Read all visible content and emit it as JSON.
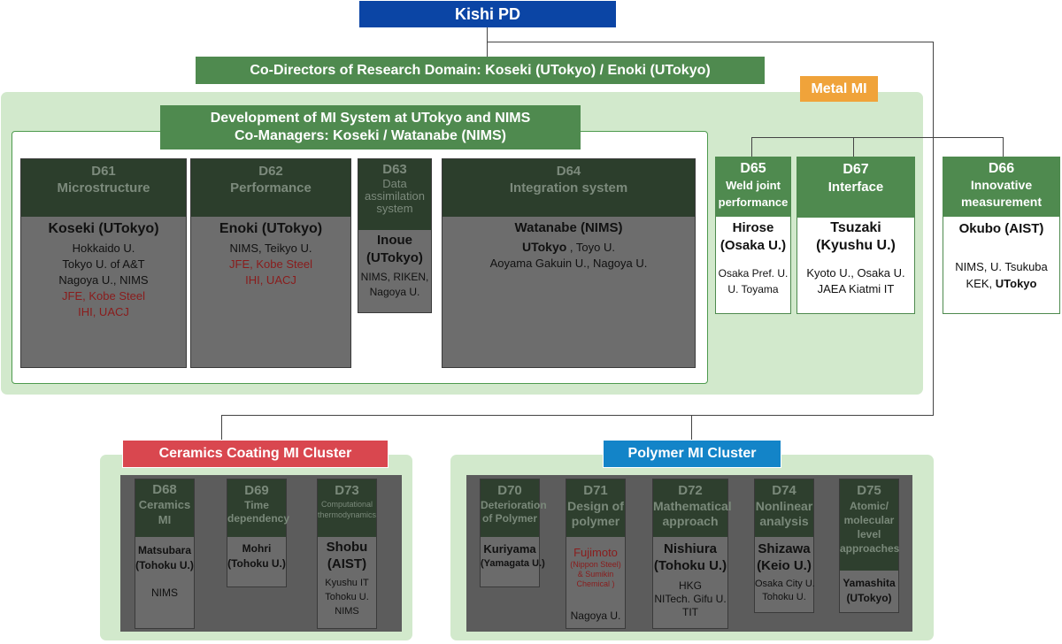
{
  "pd": "Kishi PD",
  "codirectors": "Co-Directors of Research Domain: Koseki (UTokyo) / Enoki (UTokyo)",
  "metal_label": "Metal MI",
  "dev": {
    "line1": "Development of MI System at UTokyo and NIMS",
    "line2": "Co-Managers: Koseki / Watanabe (NIMS)"
  },
  "d61": {
    "code": "D61",
    "title": "Microstructure",
    "leader": "Koseki (UTokyo)",
    "m1": "Hokkaido U.",
    "m2": "Tokyo U. of A&T",
    "m3": "Nagoya U., NIMS",
    "m4": "JFE, Kobe Steel",
    "m5": "IHI, UACJ"
  },
  "d62": {
    "code": "D62",
    "title": "Performance",
    "leader": "Enoki (UTokyo)",
    "m1": "NIMS, Teikyo U.",
    "m2": "JFE, Kobe Steel",
    "m3": "IHI, UACJ"
  },
  "d63": {
    "code": "D63",
    "t1": "Data",
    "t2": "assimilation",
    "t3": "system",
    "l1": "Inoue",
    "l2": "(UTokyo)",
    "m1": "NIMS, RIKEN,",
    "m2": "Nagoya U."
  },
  "d64": {
    "code": "D64",
    "title": "Integration system",
    "leader": "Watanabe (NIMS)",
    "m1a": "UTokyo",
    "m1b": " , Toyo U.",
    "m2": "Aoyama Gakuin U., Nagoya U."
  },
  "d65": {
    "code": "D65",
    "t1": "Weld joint",
    "t2": "performance",
    "l1": "Hirose",
    "l2": "(Osaka U.)",
    "m1": "Osaka Pref. U.",
    "m2": "U. Toyama"
  },
  "d67": {
    "code": "D67",
    "title": "Interface",
    "l1": "Tsuzaki",
    "l2": "(Kyushu U.)",
    "m1": "Kyoto U., Osaka U.",
    "m2": "JAEA Kiatmi IT"
  },
  "d66": {
    "code": "D66",
    "t1": "Innovative",
    "t2": "measurement",
    "leader": "Okubo (AIST)",
    "m1": "NIMS, U. Tsukuba",
    "m2a": "KEK, ",
    "m2b": "UTokyo"
  },
  "ceramics": "Ceramics Coating MI Cluster",
  "polymer": "Polymer MI Cluster",
  "d68": {
    "code": "D68",
    "t1": "Ceramics",
    "t2": "MI",
    "l1": "Matsubara",
    "l2": "(Tohoku U.)",
    "m1": "NIMS"
  },
  "d69": {
    "code": "D69",
    "t1": "Time",
    "t2": "dependency",
    "l1": "Mohri",
    "l2": "(Tohoku U.)"
  },
  "d73": {
    "code": "D73",
    "t1": "Computational",
    "t2": "thermodynamics",
    "l1": "Shobu",
    "l2": "(AIST)",
    "m1": "Kyushu IT",
    "m2": "Tohoku U.",
    "m3": "NIMS"
  },
  "d70": {
    "code": "D70",
    "t1": "Deterioration",
    "t2": "of Polymer",
    "l1": "Kuriyama",
    "l2": "(Yamagata U.)"
  },
  "d71": {
    "code": "D71",
    "t1": "Design of",
    "t2": "polymer",
    "l1": "Fujimoto",
    "l2": "(Nippon Steel)",
    "l3": "& Sumikin",
    "l4": "Chemical )",
    "m1": "Nagoya U."
  },
  "d72": {
    "code": "D72",
    "t1": "Mathematical",
    "t2": "approach",
    "l1": "Nishiura",
    "l2": "(Tohoku U.)",
    "m1": "HKG",
    "m2": "NITech. Gifu U.",
    "m3": "TIT"
  },
  "d74": {
    "code": "D74",
    "t1": "Nonlinear",
    "t2": "analysis",
    "l1": "Shizawa",
    "l2": "(Keio U.)",
    "m1": "Osaka City U.",
    "m2": "Tohoku U."
  },
  "d75": {
    "code": "D75",
    "t1": "Atomic/",
    "t2": "molecular",
    "t3": "level",
    "t4": "approaches",
    "l1": "Yamashita",
    "l2": "(UTokyo)"
  },
  "colors": {
    "pd": "#0b45a5",
    "green_header": "#4f8a4f",
    "region": "#d2e9cc",
    "metal": "#f0a33a",
    "ceramics": "#d9474f",
    "polymer": "#1384c8",
    "red_text": "#8a1c1c"
  }
}
